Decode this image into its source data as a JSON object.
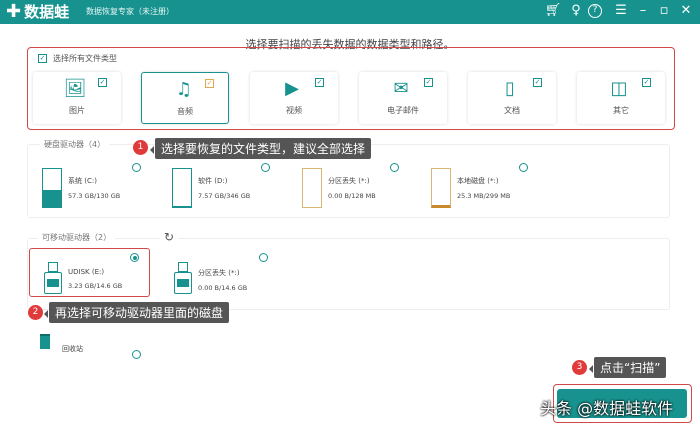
{
  "app": {
    "logo": "数据蛙",
    "subtitle": "数据恢复专家（未注册）"
  },
  "window_icons": [
    "cart-icon",
    "key-icon",
    "help-icon",
    "menu-icon",
    "minimize-icon",
    "maximize-icon",
    "close-icon"
  ],
  "page_title": "选择要扫描的丢失数据的数据类型和路径。",
  "select_all": "选择所有文件类型",
  "file_types": [
    {
      "label": "图片",
      "icon": "image-icon",
      "checked": true
    },
    {
      "label": "音频",
      "icon": "audio-icon",
      "checked": true
    },
    {
      "label": "视频",
      "icon": "video-icon",
      "checked": true
    },
    {
      "label": "电子邮件",
      "icon": "email-icon",
      "checked": true
    },
    {
      "label": "文档",
      "icon": "document-icon",
      "checked": true
    },
    {
      "label": "其它",
      "icon": "other-icon",
      "checked": true
    }
  ],
  "hard_drives": {
    "label": "硬盘驱动器（4）",
    "items": [
      {
        "name": "系统 (C:)",
        "size": "57.3 GB/130 GB"
      },
      {
        "name": "软件 (D:)",
        "size": "7.57 GB/346 GB"
      },
      {
        "name": "分区丢失 (*:)",
        "size": "0.00  B/128 MB"
      },
      {
        "name": "本地磁盘 (*:)",
        "size": "25.3 MB/299 MB"
      }
    ]
  },
  "removable": {
    "label": "可移动驱动器（2）",
    "items": [
      {
        "name": "UDISK (E:)",
        "size": "3.23 GB/14.6 GB",
        "selected": true
      },
      {
        "name": "分区丢失 (*:)",
        "size": "0.00  B/14.6 GB",
        "selected": false
      }
    ]
  },
  "recycle_bin": "回收站",
  "callouts": [
    {
      "num": "1",
      "text": "选择要恢复的文件类型，建议全部选择"
    },
    {
      "num": "2",
      "text": "再选择可移动驱动器里面的磁盘"
    },
    {
      "num": "3",
      "text": "点击“扫描”"
    }
  ],
  "watermark": "头条 @数据蛙软件",
  "colors": {
    "brand": "#17928e",
    "highlight": "#d04848"
  }
}
